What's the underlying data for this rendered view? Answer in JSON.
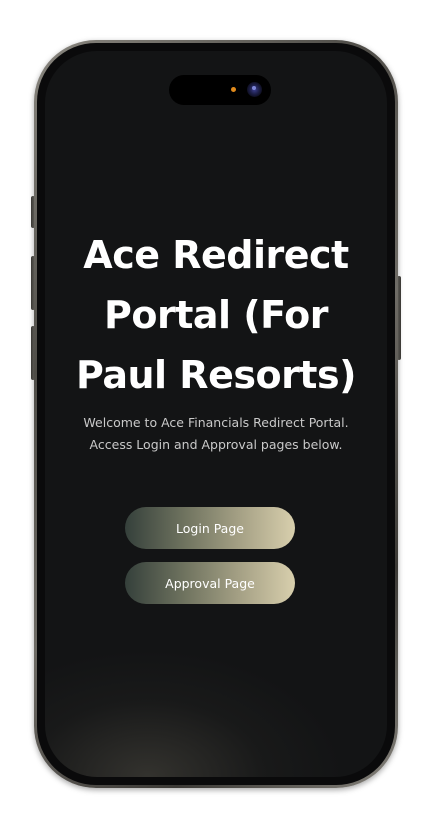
{
  "page": {
    "title": "Ace Redirect Portal (For Paul Resorts)",
    "description": "Welcome to Ace Financials Redirect Portal. Access Login and Approval pages below."
  },
  "buttons": {
    "login_label": "Login Page",
    "approval_label": "Approval Page"
  },
  "colors": {
    "screen_background": "#131415",
    "button_gradient_start": "#35403b",
    "button_gradient_end": "#d8cfad",
    "title_text": "#ffffff"
  }
}
